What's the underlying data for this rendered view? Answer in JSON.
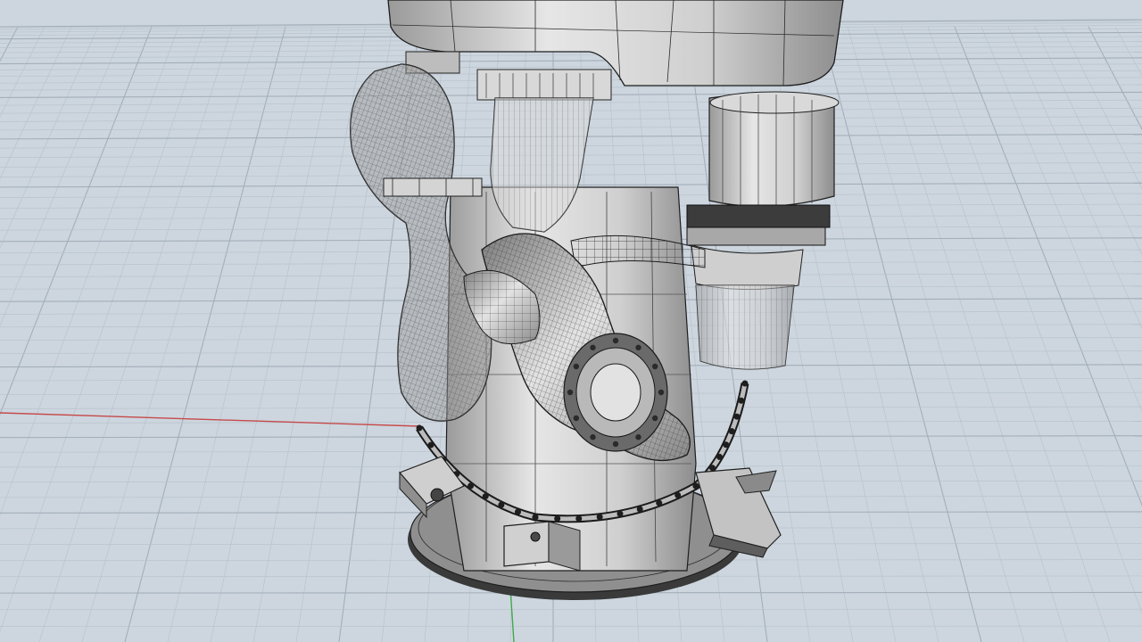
{
  "viewport": {
    "projection": "perspective",
    "display_mode": "shaded-with-isocurves",
    "grid_visible": true,
    "colors": {
      "background": "#cdd6df",
      "grid_minor": "#b9c3cc",
      "grid_major": "#a3aeb9",
      "x_axis": "#c54a4a",
      "y_axis": "#3fa94a",
      "model_fill_light": "#ececec",
      "model_fill_mid": "#c9c9c9",
      "model_fill_dark": "#8e8e8e",
      "model_edge": "#1f1f1f"
    }
  },
  "model": {
    "subject": "engine-assembly-wireframe",
    "parts": [
      "gearbox-housing",
      "cylinder-motor",
      "exhaust-pipe",
      "intake-hose",
      "wiring-harness",
      "mounting-flange",
      "support-bracket",
      "base-disc"
    ]
  }
}
